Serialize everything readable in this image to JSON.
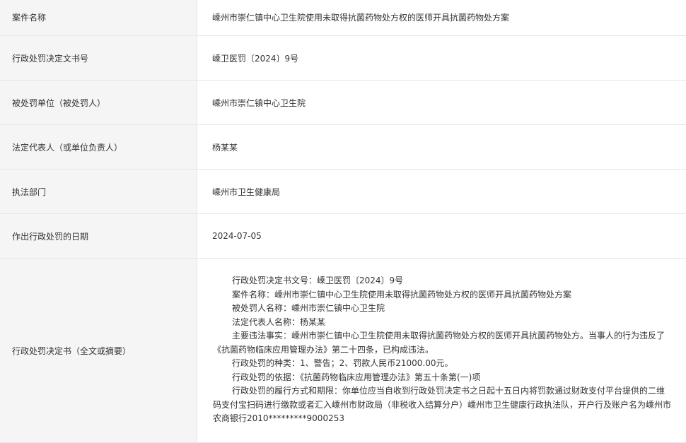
{
  "rows": [
    {
      "label": "案件名称",
      "value": "嵊州市崇仁镇中心卫生院使用未取得抗菌药物处方权的医师开具抗菌药物处方案"
    },
    {
      "label": "行政处罚决定文书号",
      "value": "嵊卫医罚〔2024〕9号"
    },
    {
      "label": "被处罚单位（被处罚人）",
      "value": "嵊州市崇仁镇中心卫生院"
    },
    {
      "label": "法定代表人（或单位负责人）",
      "value": "杨某某"
    },
    {
      "label": "执法部门",
      "value": "嵊州市卫生健康局"
    },
    {
      "label": "作出行政处罚的日期",
      "value": "2024-07-05"
    }
  ],
  "decision": {
    "label": "行政处罚决定书（全文或摘要）",
    "paragraphs": [
      "行政处罚决定书文号：嵊卫医罚〔2024〕9号",
      "案件名称：嵊州市崇仁镇中心卫生院使用未取得抗菌药物处方权的医师开具抗菌药物处方案",
      "被处罚人名称：嵊州市崇仁镇中心卫生院",
      "法定代表人名称：杨某某",
      "主要违法事实：嵊州市崇仁镇中心卫生院使用未取得抗菌药物处方权的医师开具抗菌药物处方。当事人的行为违反了《抗菌药物临床应用管理办法》第二十四条，已构成违法。",
      "行政处罚的种类：1、警告；2、罚款人民币21000.00元。",
      "行政处罚的依据：《抗菌药物临床应用管理办法》第五十条第(一)项",
      "行政处罚的履行方式和期限：你单位应当自收到行政处罚决定书之日起十五日内将罚款通过财政支付平台提供的二维码支付宝扫码进行缴款或者汇入嵊州市财政局（非税收入结算分户）嵊州市卫生健康行政执法队，开户行及账户名为嵊州市农商银行2010*********9000253"
    ]
  }
}
